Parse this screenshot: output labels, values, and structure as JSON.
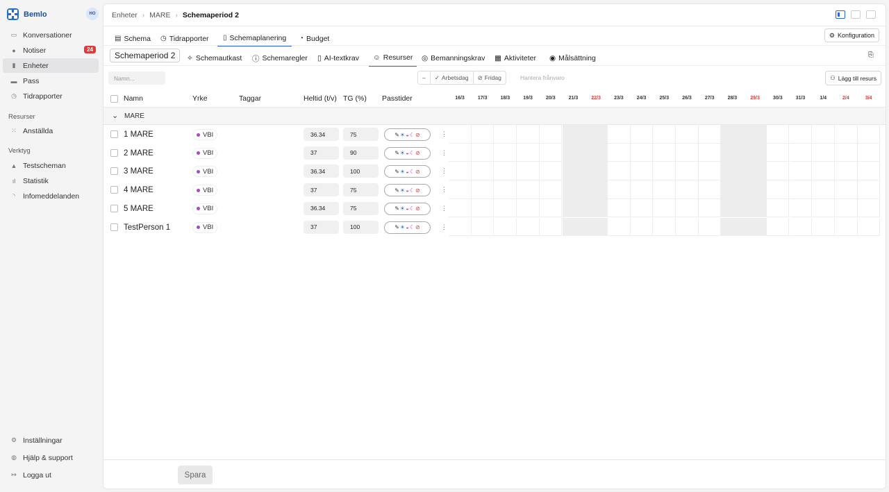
{
  "app": {
    "name": "Bemlo",
    "avatar_initials": "HO"
  },
  "sidebar": {
    "main_items": [
      {
        "label": "Konversationer",
        "icon": "chat-icon"
      },
      {
        "label": "Notiser",
        "icon": "bell-icon",
        "badge": "24"
      },
      {
        "label": "Enheter",
        "icon": "building-icon",
        "active": true
      },
      {
        "label": "Pass",
        "icon": "briefcase-icon"
      },
      {
        "label": "Tidrapporter",
        "icon": "clock-icon"
      }
    ],
    "section_resources": "Resurser",
    "resource_items": [
      {
        "label": "Anställda",
        "icon": "grid-icon"
      }
    ],
    "section_tools": "Verktyg",
    "tool_items": [
      {
        "label": "Testscheman",
        "icon": "hat-icon"
      },
      {
        "label": "Statistik",
        "icon": "bar-chart-icon"
      },
      {
        "label": "Infomeddelanden",
        "icon": "rss-icon"
      }
    ],
    "bottom_items": [
      {
        "label": "Inställningar",
        "icon": "gear-icon"
      },
      {
        "label": "Hjälp & support",
        "icon": "globe-icon"
      },
      {
        "label": "Logga ut",
        "icon": "logout-icon"
      }
    ]
  },
  "breadcrumb": {
    "items": [
      "Enheter",
      "MARE"
    ],
    "current": "Schemaperiod 2"
  },
  "tabs": [
    {
      "label": "Schema",
      "icon": "calendar-icon"
    },
    {
      "label": "Tidrapporter",
      "icon": "clock-icon"
    },
    {
      "label": "Schemaplanering",
      "icon": "clipboard-icon",
      "active": true
    },
    {
      "label": "Budget",
      "icon": "pie-icon"
    }
  ],
  "konfiguration_label": "Konfiguration",
  "period_label": "Schemaperiod 2",
  "subtabs": [
    {
      "label": "Schemautkast",
      "icon": "sparkle-icon"
    },
    {
      "label": "Schemaregler",
      "icon": "info-icon"
    },
    {
      "label": "AI-textkrav",
      "icon": "doc-icon"
    },
    {
      "label": "Resurser",
      "icon": "users-icon",
      "active": true
    },
    {
      "label": "Bemanningskrav",
      "icon": "database-icon"
    },
    {
      "label": "Aktiviteter",
      "icon": "activity-icon"
    },
    {
      "label": "Målsättning",
      "icon": "target-icon"
    }
  ],
  "filter": {
    "name_placeholder": "Namn...",
    "seg_minus": "–",
    "seg_arbetsdag": "Arbetsdag",
    "seg_fridag": "Fridag",
    "hantera": "Hantera frånvaro",
    "add_label": "Lägg till resurs"
  },
  "columns": {
    "name": "Namn",
    "yrke": "Yrke",
    "taggar": "Taggar",
    "heltid": "Heltid (t/v)",
    "tg": "TG (%)",
    "passtider": "Passtider"
  },
  "dates": [
    {
      "label": "16/3"
    },
    {
      "label": "17/3"
    },
    {
      "label": "18/3"
    },
    {
      "label": "19/3"
    },
    {
      "label": "20/3"
    },
    {
      "label": "21/3",
      "weekend": true
    },
    {
      "label": "22/3",
      "weekend": true,
      "red": true
    },
    {
      "label": "23/3"
    },
    {
      "label": "24/3"
    },
    {
      "label": "25/3"
    },
    {
      "label": "26/3"
    },
    {
      "label": "27/3"
    },
    {
      "label": "28/3",
      "weekend": true
    },
    {
      "label": "29/3",
      "weekend": true,
      "red": true
    },
    {
      "label": "30/3"
    },
    {
      "label": "31/3"
    },
    {
      "label": "1/4"
    },
    {
      "label": "2/4",
      "red": true
    },
    {
      "label": "3/4",
      "red": true
    }
  ],
  "group": {
    "name": "MARE"
  },
  "rows": [
    {
      "name": "1 MARE",
      "yrke": "VBI",
      "heltid": "36.34",
      "tg": "75"
    },
    {
      "name": "2 MARE",
      "yrke": "VBI",
      "heltid": "37",
      "tg": "90"
    },
    {
      "name": "3 MARE",
      "yrke": "VBI",
      "heltid": "36.34",
      "tg": "100"
    },
    {
      "name": "4 MARE",
      "yrke": "VBI",
      "heltid": "37",
      "tg": "75"
    },
    {
      "name": "5 MARE",
      "yrke": "VBI",
      "heltid": "36.34",
      "tg": "75"
    },
    {
      "name": "TestPerson 1",
      "yrke": "VBI",
      "heltid": "37",
      "tg": "100"
    }
  ],
  "pass_icons": [
    {
      "icon": "pencil-icon",
      "glyph": "✎",
      "color": "#333333"
    },
    {
      "icon": "sun-icon",
      "glyph": "☀",
      "color": "#2563eb"
    },
    {
      "icon": "sunset-icon",
      "glyph": "◒",
      "color": "#d9466d"
    },
    {
      "icon": "moon-icon",
      "glyph": "☾",
      "color": "#8a3fb8"
    },
    {
      "icon": "no-clock-icon",
      "glyph": "⊘",
      "color": "#e03a3a"
    }
  ],
  "save_label": "Spara"
}
